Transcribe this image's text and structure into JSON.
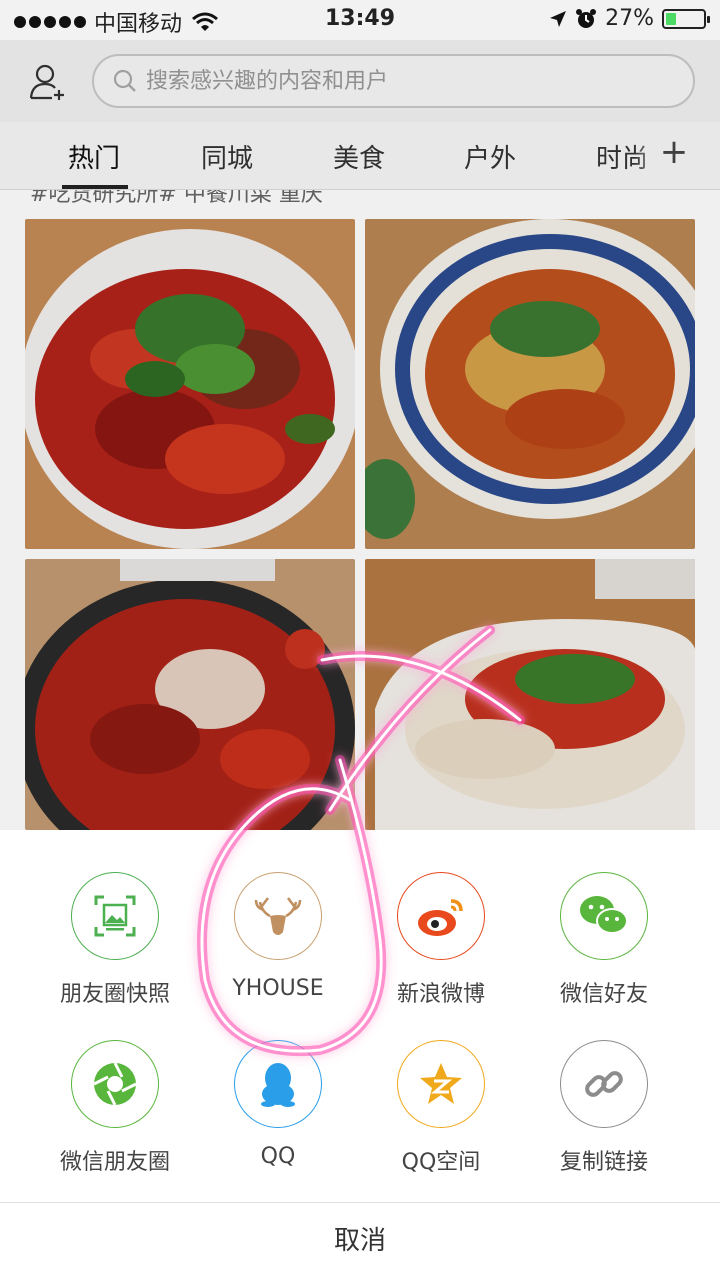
{
  "status_bar": {
    "carrier": "中国移动",
    "time": "13:49",
    "battery": "27%",
    "battery_level": 0.27
  },
  "header": {
    "search_placeholder": "搜索感兴趣的内容和用户"
  },
  "tabs": {
    "items": [
      "热门",
      "同城",
      "美食",
      "户外",
      "时尚"
    ],
    "active": "热门",
    "add_label": "+"
  },
  "feed": {
    "caption": "#吃货研究所# 中餐川菜 重庆"
  },
  "share": {
    "items": [
      {
        "label": "朋友圈快照",
        "icon": "snapshot-icon",
        "color": "#4caf50"
      },
      {
        "label": "YHOUSE",
        "icon": "deer-icon",
        "color": "#c8a070"
      },
      {
        "label": "新浪微博",
        "icon": "weibo-icon",
        "color": "#e8491d"
      },
      {
        "label": "微信好友",
        "icon": "wechat-icon",
        "color": "#58b63c"
      },
      {
        "label": "微信朋友圈",
        "icon": "moments-icon",
        "color": "#58b63c"
      },
      {
        "label": "QQ",
        "icon": "qq-icon",
        "color": "#2a9ee8"
      },
      {
        "label": "QQ空间",
        "icon": "qzone-icon",
        "color": "#f1a91c"
      },
      {
        "label": "复制链接",
        "icon": "link-icon",
        "color": "#8c8c8c"
      }
    ],
    "cancel_label": "取消"
  }
}
